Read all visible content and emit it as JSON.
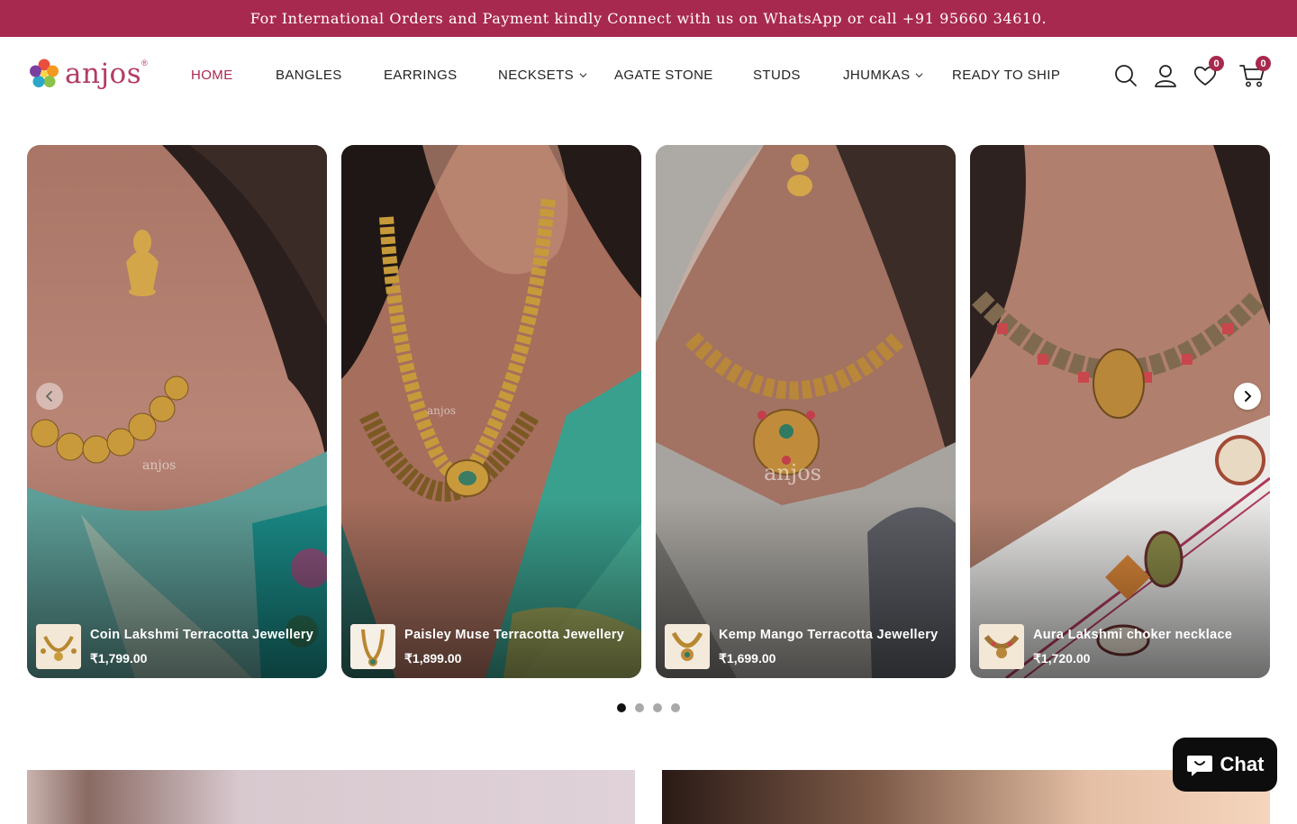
{
  "announcement": "For International Orders and Payment kindly Connect with us on WhatsApp or call +91 95660 34610.",
  "brand": {
    "name": "anjos",
    "mark": "®"
  },
  "nav": [
    {
      "label": "HOME",
      "active": true
    },
    {
      "label": "BANGLES"
    },
    {
      "label": "EARRINGS"
    },
    {
      "label": "NECKSETS",
      "dropdown": true
    },
    {
      "label": "AGATE STONE"
    },
    {
      "label": "STUDS"
    },
    {
      "label": "JHUMKAS",
      "dropdown": true
    },
    {
      "label": "READY TO SHIP"
    }
  ],
  "header_icons": {
    "search": "search-icon",
    "account": "user-icon",
    "wishlist": "heart-icon",
    "cart": "cart-icon"
  },
  "wishlist_count": "0",
  "cart_count": "0",
  "products": [
    {
      "title": "Coin Lakshmi Terracotta Jewellery",
      "price": "₹1,799.00"
    },
    {
      "title": "Paisley Muse Terracotta Jewellery",
      "price": "₹1,899.00"
    },
    {
      "title": "Kemp Mango Terracotta Jewellery",
      "price": "₹1,699.00"
    },
    {
      "title": "Aura Lakshmi choker necklace",
      "price": "₹1,720.00"
    }
  ],
  "watermarks": [
    "anjos",
    "anjos",
    "anjos"
  ],
  "carousel": {
    "pages": 4,
    "current": 1
  },
  "chat": {
    "label": "Chat"
  },
  "colors": {
    "brand": "#a8294f",
    "chat_bg": "#0d0d0d"
  }
}
